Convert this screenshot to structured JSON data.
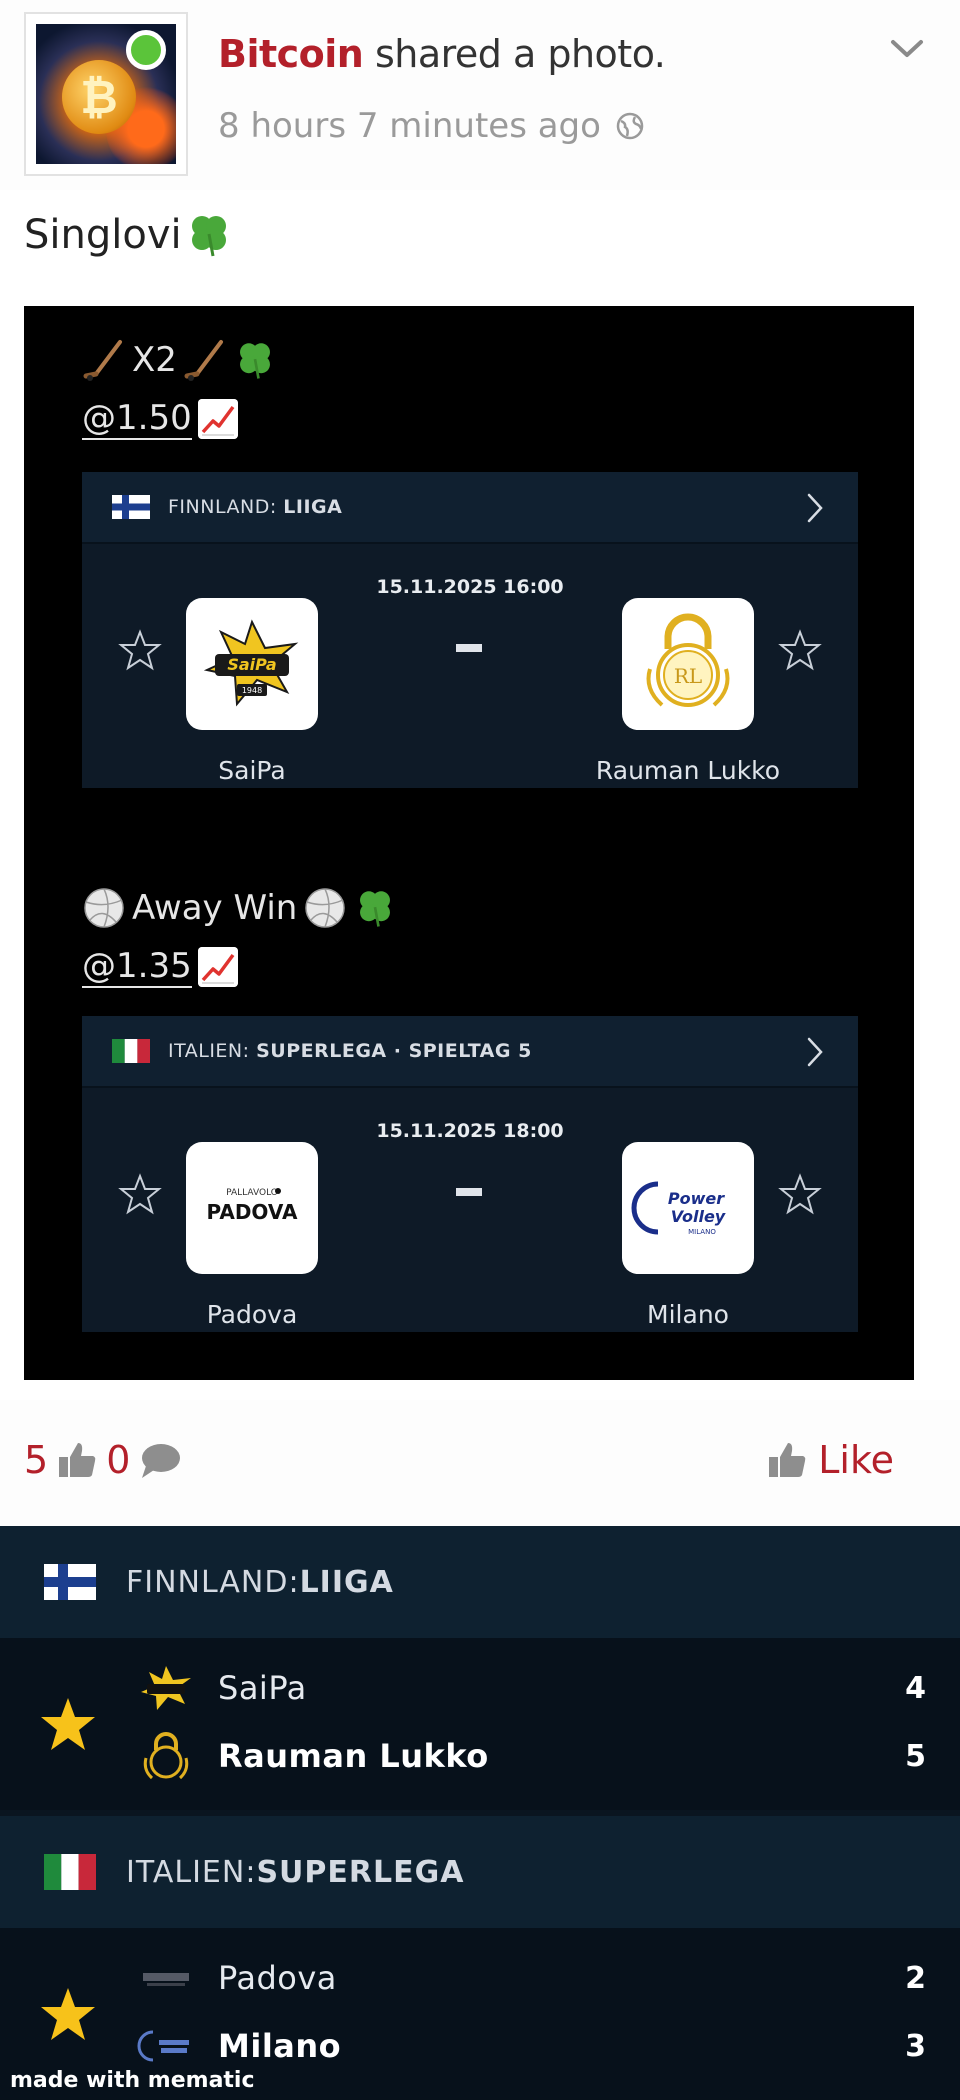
{
  "post": {
    "author": "Bitcoin",
    "action": " shared a photo.",
    "time": "8 hours 7 minutes ago",
    "caption": "Singlovi",
    "avatar_symbol": "₿",
    "icons": {
      "globe": "globe-icon",
      "chevron": "chevron-down-icon",
      "clover": "four-leaf-clover-icon"
    }
  },
  "photo": {
    "picks": [
      {
        "title": "X2",
        "odds": "@1.50",
        "sport_icon": "hockey-stick-icon"
      },
      {
        "title": "Away Win",
        "odds": "@1.35",
        "sport_icon": "volleyball-icon"
      }
    ],
    "matches": [
      {
        "league_country": "FINNLAND: ",
        "league_name": "LIIGA",
        "datetime": "15.11.2025 16:00",
        "home": "SaiPa",
        "away": "Rauman Lukko",
        "home_logo_text": "SaiPa",
        "home_logo_year": "1948",
        "away_logo_text": "RL"
      },
      {
        "league_country": "ITALIEN: ",
        "league_name": "SUPERLEGA · SPIELTAG 5",
        "datetime": "15.11.2025 18:00",
        "home": "Padova",
        "away": "Milano",
        "home_logo_small": "PALLAVOLO",
        "home_logo_text": "PADOVA",
        "away_logo_text_1": "Power",
        "away_logo_text_2": "Volley",
        "away_logo_text_3": "MILANO"
      }
    ]
  },
  "reactions": {
    "likes": "5",
    "comments": "0",
    "like_label": "Like"
  },
  "results": [
    {
      "league_country": "FINNLAND: ",
      "league_name": "LIIGA",
      "home": "SaiPa",
      "home_score": "4",
      "away": "Rauman Lukko",
      "away_score": "5"
    },
    {
      "league_country": "ITALIEN: ",
      "league_name": "SUPERLEGA",
      "home": "Padova",
      "home_score": "2",
      "away": "Milano",
      "away_score": "3"
    }
  ],
  "watermark": "made with mematic",
  "colors": {
    "brand_red": "#b3202a",
    "card_bg": "#0e1a27",
    "results_bg": "#0a1520",
    "star_gold": "#f7c21a",
    "online_green": "#5bc43a"
  }
}
